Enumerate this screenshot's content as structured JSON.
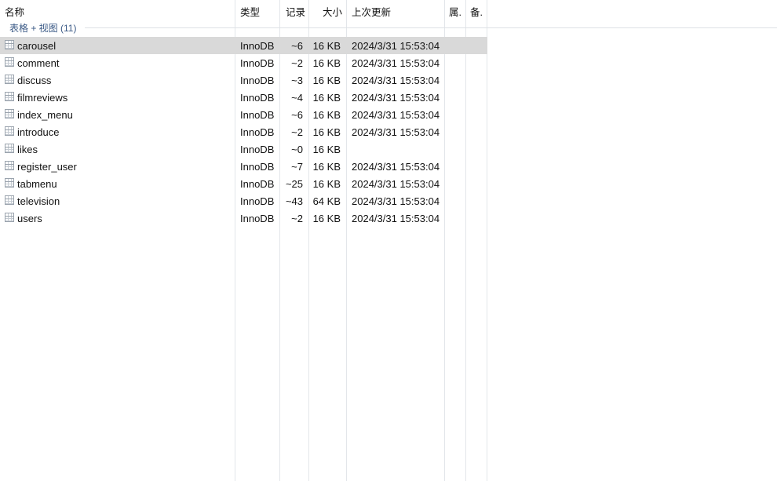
{
  "columns": {
    "name": "名称",
    "type": "类型",
    "rows": "记录",
    "size": "大小",
    "updated": "上次更新",
    "attr": "属.",
    "comment": "备."
  },
  "group": {
    "label": "表格 + 视图 (11)"
  },
  "tables": [
    {
      "name": "carousel",
      "engine": "InnoDB",
      "rows": "~6",
      "size": "16 KB",
      "updated": "2024/3/31 15:53:04",
      "selected": true
    },
    {
      "name": "comment",
      "engine": "InnoDB",
      "rows": "~2",
      "size": "16 KB",
      "updated": "2024/3/31 15:53:04"
    },
    {
      "name": "discuss",
      "engine": "InnoDB",
      "rows": "~3",
      "size": "16 KB",
      "updated": "2024/3/31 15:53:04"
    },
    {
      "name": "filmreviews",
      "engine": "InnoDB",
      "rows": "~4",
      "size": "16 KB",
      "updated": "2024/3/31 15:53:04"
    },
    {
      "name": "index_menu",
      "engine": "InnoDB",
      "rows": "~6",
      "size": "16 KB",
      "updated": "2024/3/31 15:53:04"
    },
    {
      "name": "introduce",
      "engine": "InnoDB",
      "rows": "~2",
      "size": "16 KB",
      "updated": "2024/3/31 15:53:04"
    },
    {
      "name": "likes",
      "engine": "InnoDB",
      "rows": "~0",
      "size": "16 KB",
      "updated": ""
    },
    {
      "name": "register_user",
      "engine": "InnoDB",
      "rows": "~7",
      "size": "16 KB",
      "updated": "2024/3/31 15:53:04"
    },
    {
      "name": "tabmenu",
      "engine": "InnoDB",
      "rows": "~25",
      "size": "16 KB",
      "updated": "2024/3/31 15:53:04"
    },
    {
      "name": "television",
      "engine": "InnoDB",
      "rows": "~43",
      "size": "64 KB",
      "updated": "2024/3/31 15:53:04"
    },
    {
      "name": "users",
      "engine": "InnoDB",
      "rows": "~2",
      "size": "16 KB",
      "updated": "2024/3/31 15:53:04"
    }
  ],
  "icons": {
    "table": "table-grid-icon"
  }
}
